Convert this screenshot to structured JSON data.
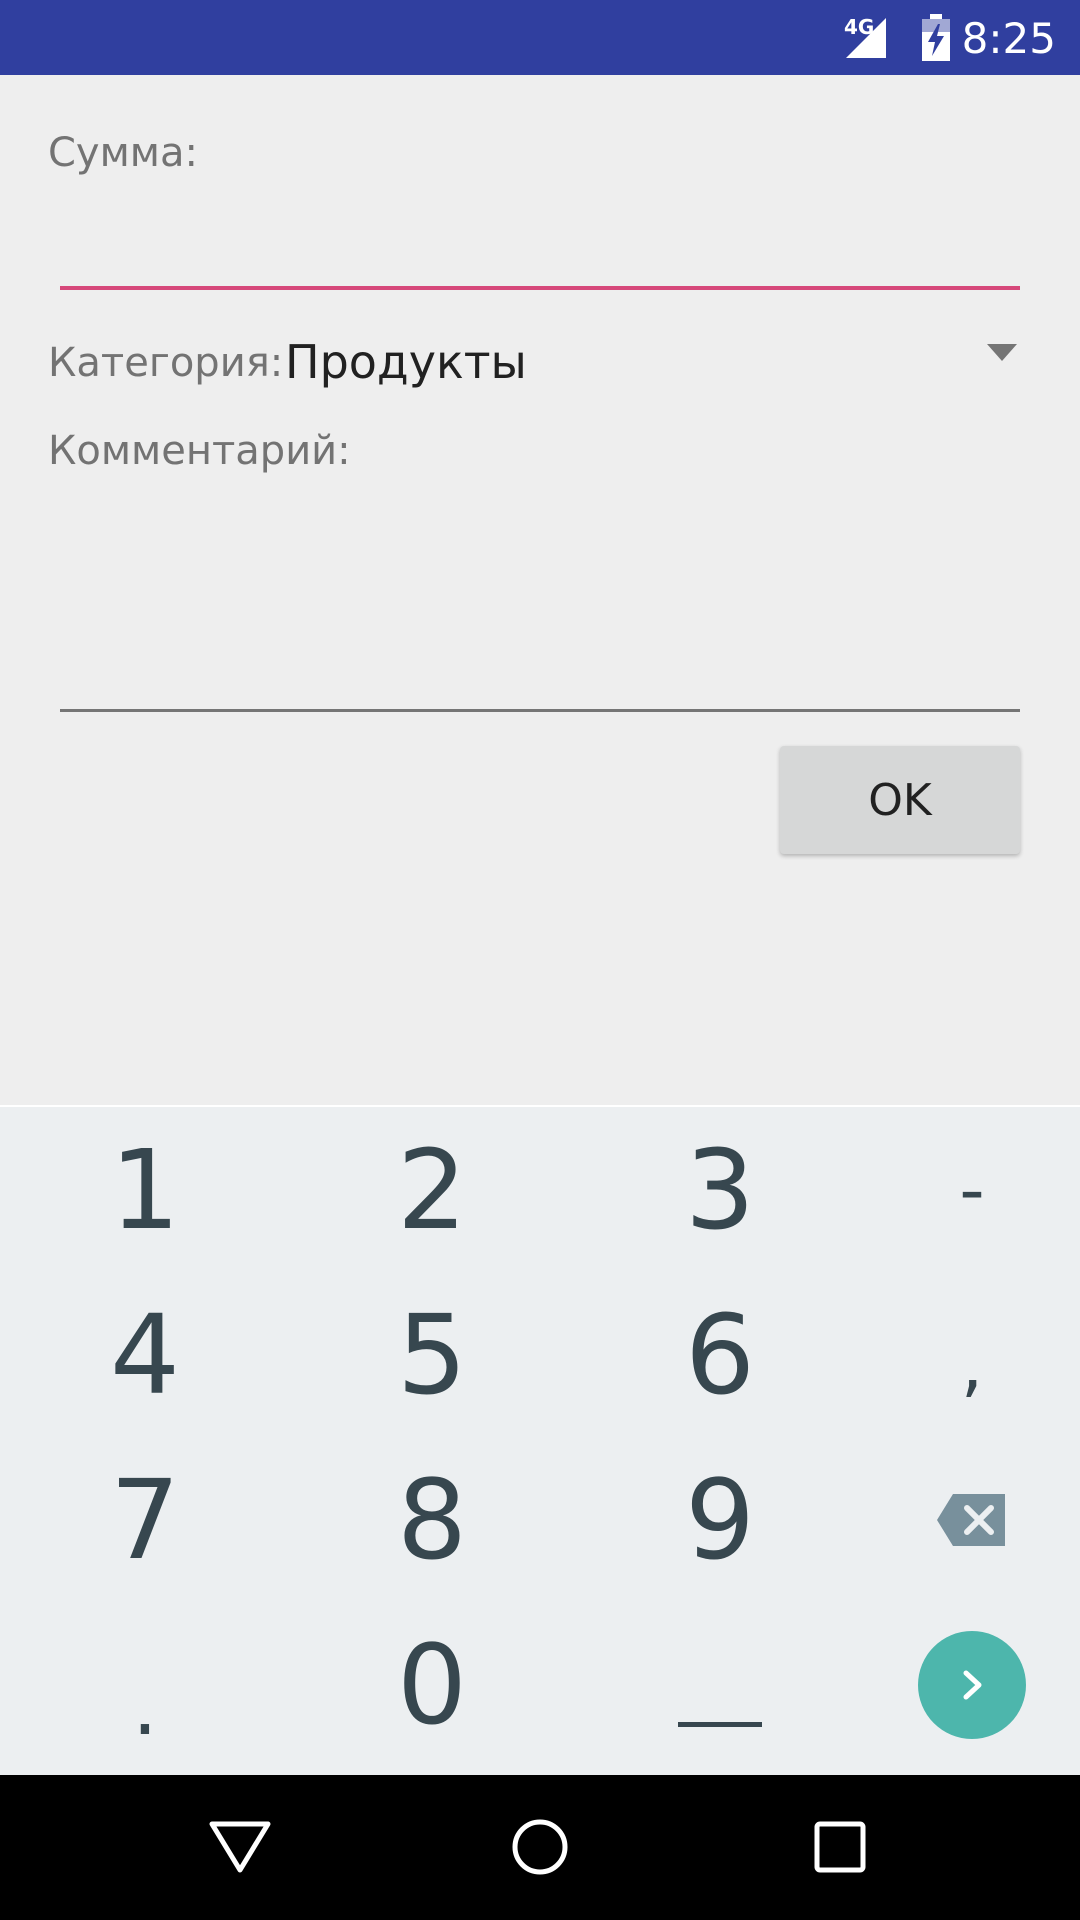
{
  "status_bar": {
    "time": "8:25",
    "network": "4G",
    "icons": [
      "signal-4g-icon",
      "battery-charging-icon"
    ],
    "background": "#303F9F"
  },
  "form": {
    "amount_label": "Сумма:",
    "amount_value": "",
    "category_label": "Категория:",
    "category_value": "Продукты",
    "comment_label": "Комментарий:",
    "comment_value": "",
    "ok_label": "OK",
    "accent_color": "#D6487A"
  },
  "keyboard": {
    "rows": [
      [
        "1",
        "2",
        "3",
        "-"
      ],
      [
        "4",
        "5",
        "6",
        ","
      ],
      [
        "7",
        "8",
        "9",
        "backspace-icon"
      ],
      [
        ".",
        "0",
        "space-bar-icon",
        "go-arrow-icon"
      ]
    ],
    "go_color": "#4DB6AC",
    "key_color": "#37474F"
  },
  "nav_bar": {
    "icons": [
      "back-triangle-icon",
      "home-circle-icon",
      "recents-square-icon"
    ]
  }
}
